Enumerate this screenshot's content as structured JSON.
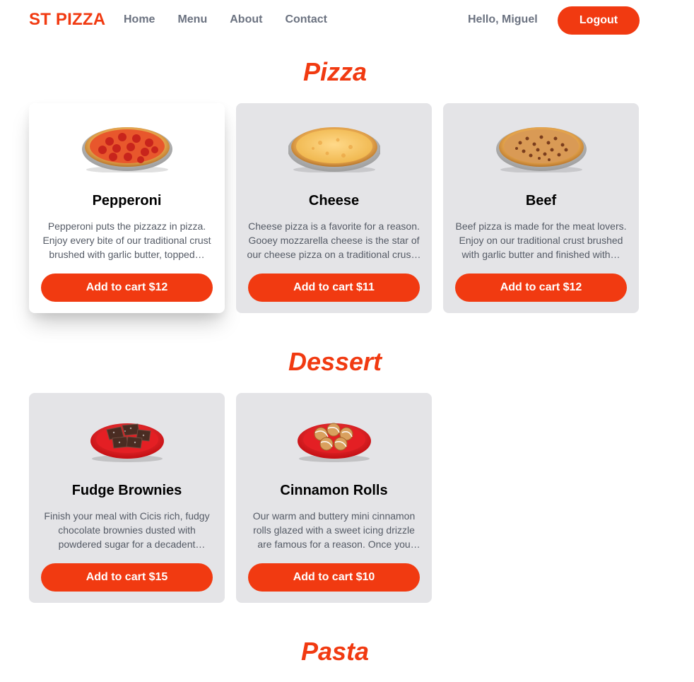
{
  "header": {
    "logo": "ST PIZZA",
    "nav": [
      "Home",
      "Menu",
      "About",
      "Contact"
    ],
    "greeting": "Hello, Miguel",
    "logout_label": "Logout"
  },
  "colors": {
    "accent": "#f13a11",
    "card_bg": "#e4e4e7",
    "nav_text": "#6b7280"
  },
  "sections": [
    {
      "title": "Pizza",
      "items": [
        {
          "name": "Pepperoni",
          "description": "Pepperoni puts the pizzazz in pizza. Enjoy every bite of our traditional crust brushed with garlic butter, topped…",
          "button": "Add to cart $12",
          "image": "pepperoni-pizza-image"
        },
        {
          "name": "Cheese",
          "description": "Cheese pizza is a favorite for a reason. Gooey mozzarella cheese is the star of our cheese pizza on a traditional crus…",
          "button": "Add to cart $11",
          "image": "cheese-pizza-image"
        },
        {
          "name": "Beef",
          "description": "Beef pizza is made for the meat lovers. Enjoy on our traditional crust brushed with garlic butter and finished with…",
          "button": "Add to cart $12",
          "image": "beef-pizza-image"
        }
      ]
    },
    {
      "title": "Dessert",
      "items": [
        {
          "name": "Fudge Brownies",
          "description": "Finish your meal with Cicis rich, fudgy chocolate brownies dusted with powdered sugar for a decadent desse…",
          "button": "Add to cart $15",
          "image": "brownies-image"
        },
        {
          "name": "Cinnamon Rolls",
          "description": "Our warm and buttery mini cinnamon rolls glazed with a sweet icing drizzle are famous for a reason. Once you try…",
          "button": "Add to cart $10",
          "image": "cinnamon-rolls-image"
        }
      ]
    },
    {
      "title": "Pasta",
      "items": []
    }
  ]
}
